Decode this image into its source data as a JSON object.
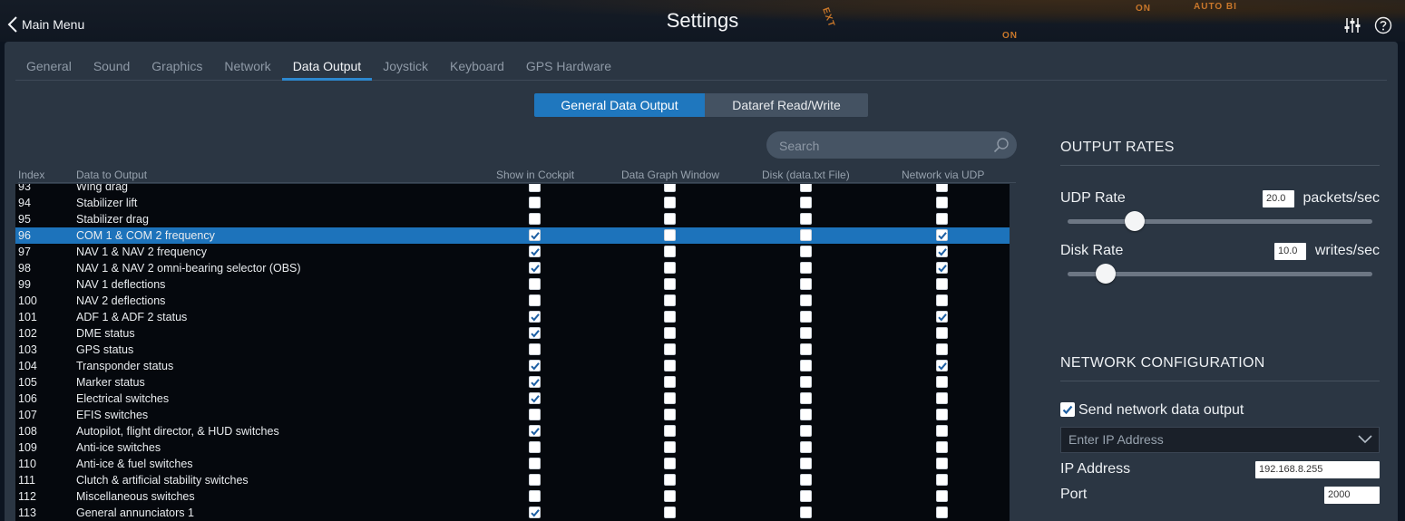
{
  "header": {
    "back_label": "Main Menu",
    "title": "Settings",
    "deco_texts": [
      "ON",
      "AUTO BI",
      "EXT",
      "ON"
    ]
  },
  "tabs": [
    {
      "label": "General",
      "active": false
    },
    {
      "label": "Sound",
      "active": false
    },
    {
      "label": "Graphics",
      "active": false
    },
    {
      "label": "Network",
      "active": false
    },
    {
      "label": "Data Output",
      "active": true
    },
    {
      "label": "Joystick",
      "active": false
    },
    {
      "label": "Keyboard",
      "active": false
    },
    {
      "label": "GPS Hardware",
      "active": false
    }
  ],
  "segment": {
    "general_label": "General Data Output",
    "dataref_label": "Dataref Read/Write"
  },
  "search": {
    "placeholder": "Search"
  },
  "table": {
    "headers": {
      "index": "Index",
      "data": "Data to Output",
      "cockpit": "Show in Cockpit",
      "graph": "Data Graph Window",
      "disk": "Disk (data.txt File)",
      "udp": "Network via UDP"
    },
    "rows": [
      {
        "index": "93",
        "name": "Wing drag",
        "cockpit": false,
        "graph": false,
        "disk": false,
        "udp": false
      },
      {
        "index": "94",
        "name": "Stabilizer lift",
        "cockpit": false,
        "graph": false,
        "disk": false,
        "udp": false
      },
      {
        "index": "95",
        "name": "Stabilizer drag",
        "cockpit": false,
        "graph": false,
        "disk": false,
        "udp": false
      },
      {
        "index": "96",
        "name": "COM 1 & COM 2 frequency",
        "cockpit": true,
        "graph": false,
        "disk": false,
        "udp": true,
        "selected": true
      },
      {
        "index": "97",
        "name": "NAV 1 & NAV 2 frequency",
        "cockpit": true,
        "graph": false,
        "disk": false,
        "udp": true
      },
      {
        "index": "98",
        "name": "NAV 1 & NAV 2 omni-bearing selector (OBS)",
        "cockpit": true,
        "graph": false,
        "disk": false,
        "udp": true
      },
      {
        "index": "99",
        "name": "NAV 1 deflections",
        "cockpit": false,
        "graph": false,
        "disk": false,
        "udp": false
      },
      {
        "index": "100",
        "name": "NAV 2 deflections",
        "cockpit": false,
        "graph": false,
        "disk": false,
        "udp": false
      },
      {
        "index": "101",
        "name": "ADF 1 & ADF 2 status",
        "cockpit": true,
        "graph": false,
        "disk": false,
        "udp": true
      },
      {
        "index": "102",
        "name": "DME status",
        "cockpit": true,
        "graph": false,
        "disk": false,
        "udp": false
      },
      {
        "index": "103",
        "name": "GPS status",
        "cockpit": false,
        "graph": false,
        "disk": false,
        "udp": false
      },
      {
        "index": "104",
        "name": "Transponder status",
        "cockpit": true,
        "graph": false,
        "disk": false,
        "udp": true
      },
      {
        "index": "105",
        "name": "Marker status",
        "cockpit": true,
        "graph": false,
        "disk": false,
        "udp": false
      },
      {
        "index": "106",
        "name": "Electrical switches",
        "cockpit": true,
        "graph": false,
        "disk": false,
        "udp": false
      },
      {
        "index": "107",
        "name": "EFIS switches",
        "cockpit": false,
        "graph": false,
        "disk": false,
        "udp": false
      },
      {
        "index": "108",
        "name": "Autopilot, flight director, & HUD switches",
        "cockpit": true,
        "graph": false,
        "disk": false,
        "udp": false
      },
      {
        "index": "109",
        "name": "Anti-ice switches",
        "cockpit": false,
        "graph": false,
        "disk": false,
        "udp": false
      },
      {
        "index": "110",
        "name": "Anti-ice & fuel switches",
        "cockpit": false,
        "graph": false,
        "disk": false,
        "udp": false
      },
      {
        "index": "111",
        "name": "Clutch & artificial stability switches",
        "cockpit": false,
        "graph": false,
        "disk": false,
        "udp": false
      },
      {
        "index": "112",
        "name": "Miscellaneous switches",
        "cockpit": false,
        "graph": false,
        "disk": false,
        "udp": false
      },
      {
        "index": "113",
        "name": "General annunciators 1",
        "cockpit": true,
        "graph": false,
        "disk": false,
        "udp": false
      }
    ]
  },
  "output_rates": {
    "title": "OUTPUT RATES",
    "udp_label": "UDP Rate",
    "udp_value": "20.0",
    "udp_unit": "packets/sec",
    "udp_slider_fraction": 0.2,
    "disk_label": "Disk Rate",
    "disk_value": "10.0",
    "disk_unit": "writes/sec",
    "disk_slider_fraction": 0.1
  },
  "network": {
    "title": "NETWORK CONFIGURATION",
    "send_label": "Send network data output",
    "send_checked": true,
    "ip_dropdown_placeholder": "Enter IP Address",
    "ip_label": "IP Address",
    "ip_value": "192.168.8.255",
    "port_label": "Port",
    "port_value": "2000"
  },
  "colors": {
    "accent": "#1f77be",
    "panel": "#2b3643",
    "table_bg": "#05080d"
  }
}
